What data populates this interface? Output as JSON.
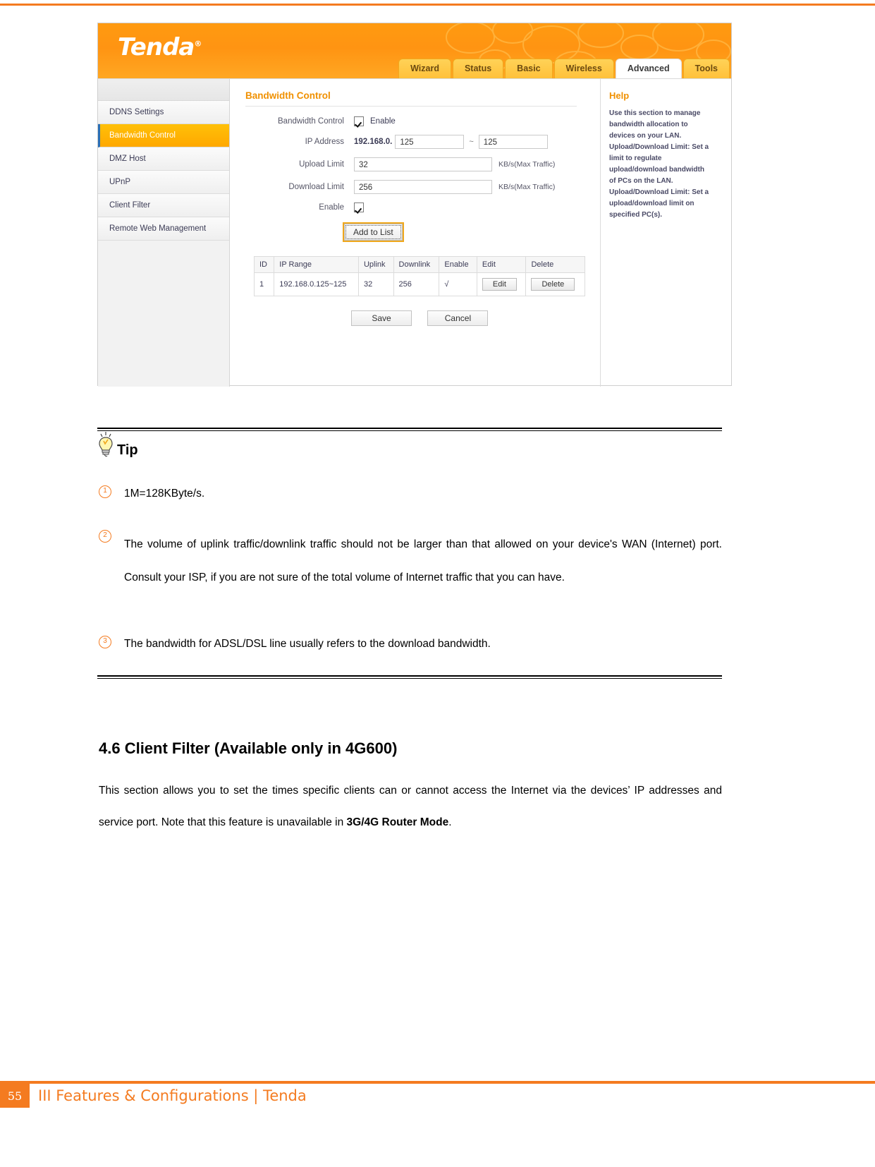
{
  "colors": {
    "brand_orange": "#f47b20",
    "ui_orange": "#ff9a10",
    "tab_yellow": "#ffc13a",
    "help_title": "#f09000"
  },
  "router_ui": {
    "logo": "Tenda",
    "logo_mark": "®",
    "tabs": [
      {
        "label": "Wizard",
        "active": false
      },
      {
        "label": "Status",
        "active": false
      },
      {
        "label": "Basic",
        "active": false
      },
      {
        "label": "Wireless",
        "active": false
      },
      {
        "label": "Advanced",
        "active": true
      },
      {
        "label": "Tools",
        "active": false
      }
    ],
    "sidebar": [
      {
        "label": "DDNS Settings",
        "active": false
      },
      {
        "label": "Bandwidth Control",
        "active": true
      },
      {
        "label": "DMZ Host",
        "active": false
      },
      {
        "label": "UPnP",
        "active": false
      },
      {
        "label": "Client Filter",
        "active": false
      },
      {
        "label": "Remote Web Management",
        "active": false
      }
    ],
    "form": {
      "section_title": "Bandwidth Control",
      "enable_row_label": "Bandwidth Control",
      "enable_checkbox_label": "Enable",
      "ip_label": "IP Address",
      "ip_prefix": "192.168.0.",
      "ip_start": "125",
      "ip_dash": "~",
      "ip_end": "125",
      "upload_label": "Upload Limit",
      "upload_value": "32",
      "upload_unit": "KB/s(Max Traffic)",
      "download_label": "Download Limit",
      "download_value": "256",
      "download_unit": "KB/s(Max Traffic)",
      "enable2_label": "Enable",
      "add_button": "Add to List",
      "save_button": "Save",
      "cancel_button": "Cancel"
    },
    "table": {
      "headers": [
        "ID",
        "IP Range",
        "Uplink",
        "Downlink",
        "Enable",
        "Edit",
        "Delete"
      ],
      "rows": [
        {
          "id": "1",
          "ip_range": "192.168.0.125~125",
          "uplink": "32",
          "downlink": "256",
          "enable": "√",
          "edit": "Edit",
          "delete": "Delete"
        }
      ]
    },
    "help": {
      "title": "Help",
      "lines": [
        "Use this section to manage",
        "bandwidth allocation to",
        "devices on your LAN.",
        "Upload/Download Limit: Set a",
        "limit to regulate",
        "upload/download bandwidth",
        "of PCs on the LAN.",
        "Upload/Download Limit: Set a",
        "upload/download limit on",
        "specified PC(s)."
      ]
    }
  },
  "tip": {
    "label": "Tip",
    "items": [
      {
        "marker": "①",
        "text": "1M=128KByte/s."
      },
      {
        "marker": "②",
        "text": "The volume of uplink traffic/downlink traffic should not be larger than that allowed on your device's WAN (Internet) port. Consult your ISP, if you are not sure of the total volume of Internet traffic that you can have."
      },
      {
        "marker": "③",
        "text": "The bandwidth for ADSL/DSL line usually refers to the download bandwidth."
      }
    ]
  },
  "document": {
    "heading": "4.6 Client Filter (Available only in 4G600)",
    "paragraph_part1": "This section allows you to set the times specific clients can or cannot access the Internet via the devices’ IP addresses and service port. Note that this feature is unavailable in ",
    "paragraph_bold": "3G/4G Router Mode",
    "paragraph_part2": "."
  },
  "footer": {
    "page_number": "55",
    "text": "III Features & Configurations | Tenda"
  }
}
